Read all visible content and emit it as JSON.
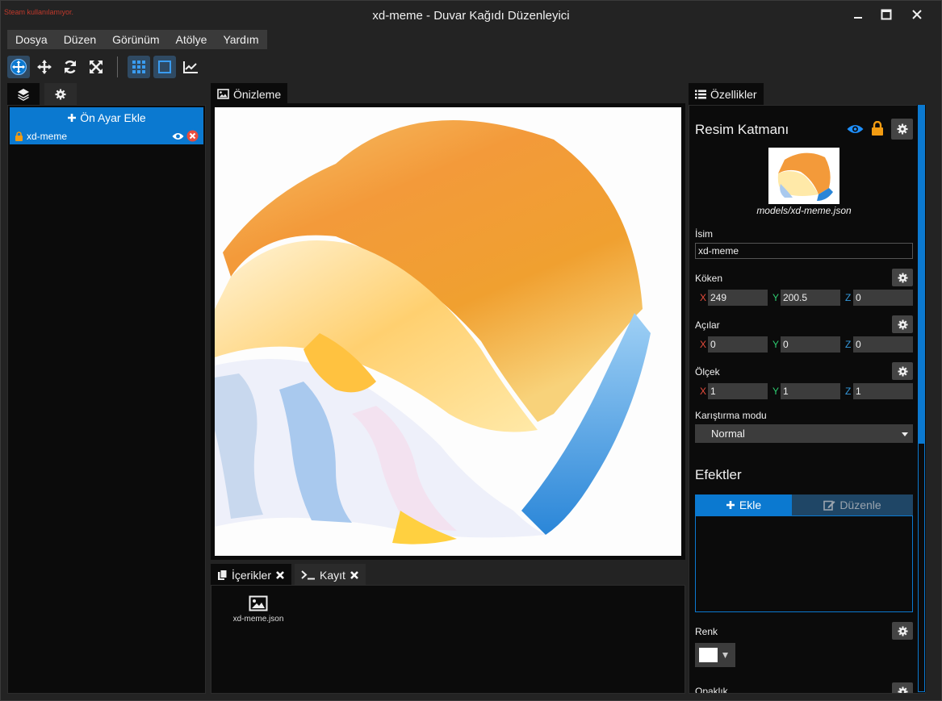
{
  "titlebar": {
    "steam_warning": "Steam kullanılamıyor.",
    "title": "xd-meme - Duvar Kağıdı Düzenleyici"
  },
  "menu": [
    "Dosya",
    "Düzen",
    "Görünüm",
    "Atölye",
    "Yardım"
  ],
  "toolbar": {
    "tools": [
      "select-move-icon",
      "move-icon",
      "rotate-icon",
      "scale-icon",
      "grid-icon",
      "frame-icon",
      "chart-icon"
    ]
  },
  "layers_panel": {
    "add_preset_label": "Ön Ayar Ekle",
    "layer": {
      "name": "xd-meme"
    }
  },
  "preview": {
    "tab_label": "Önizleme"
  },
  "bottom_panel": {
    "tabs": [
      {
        "label": "İçerikler"
      },
      {
        "label": "Kayıt"
      }
    ],
    "items": [
      {
        "name": "xd-meme.json"
      }
    ]
  },
  "properties": {
    "tab_label": "Özellikler",
    "layer_type": "Resim Katmanı",
    "model_path": "models/xd-meme.json",
    "name_label": "İsim",
    "name_value": "xd-meme",
    "origin_label": "Köken",
    "origin": {
      "x": "249",
      "y": "200.5",
      "z": "0"
    },
    "angles_label": "Açılar",
    "angles": {
      "x": "0",
      "y": "0",
      "z": "0"
    },
    "scale_label": "Ölçek",
    "scale": {
      "x": "1",
      "y": "1",
      "z": "1"
    },
    "blend_label": "Karıştırma modu",
    "blend_value": "Normal",
    "effects_title": "Efektler",
    "effects_add": "Ekle",
    "effects_edit": "Düzenle",
    "color_label": "Renk",
    "color_value": "#ffffff",
    "opacity_label": "Opaklık"
  },
  "axes": {
    "x": "X",
    "y": "Y",
    "z": "Z"
  },
  "colors": {
    "accent": "#0b79d0",
    "lock": "#f39c12",
    "axis_x": "#e74c3c",
    "axis_y": "#2ecc71",
    "axis_z": "#3498db"
  }
}
